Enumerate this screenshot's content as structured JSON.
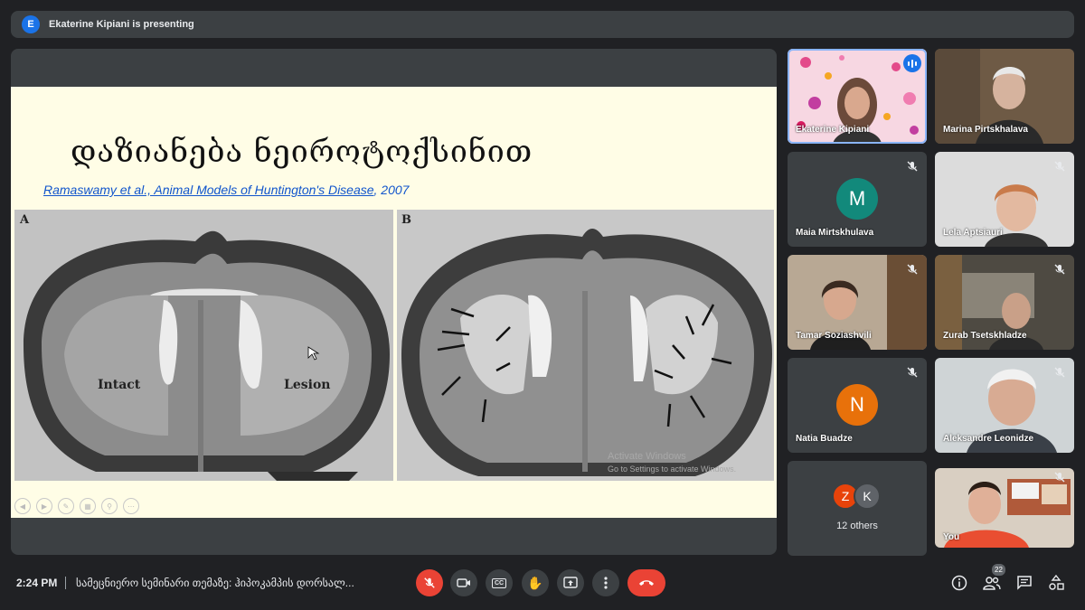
{
  "presenting": {
    "avatar_letter": "E",
    "text": "Ekaterine Kipiani is presenting"
  },
  "slide": {
    "title": "დაზიანება ნეიროტოქსინით",
    "citation_link": "Ramaswamy et al., Animal Models of Huntington's Disease",
    "citation_year": ", 2007",
    "panel_a_label": "A",
    "panel_b_label": "B",
    "label_intact": "Intact",
    "label_lesion": "Lesion",
    "watermark_1": "Activate Windows",
    "watermark_2": "Go to Settings to activate Windows."
  },
  "participants": [
    {
      "name": "Ekaterine Kipiani",
      "speaking": true
    },
    {
      "name": "Marina Pirtskhalava"
    },
    {
      "name": "Maia Mirtskhulava",
      "avatar_letter": "M",
      "avatar_color": "#12897b"
    },
    {
      "name": "Lela Aptsiauri"
    },
    {
      "name": "Tamar Soziashvili"
    },
    {
      "name": "Zurab Tsetskhladze"
    },
    {
      "name": "Natia Buadze",
      "avatar_letter": "N",
      "avatar_color": "#e8710a"
    },
    {
      "name": "Aleksandre Leonidze"
    },
    {
      "name": "You"
    }
  ],
  "others": {
    "avatar_1": "Z",
    "avatar_2": "K",
    "label": "12 others"
  },
  "bottom_bar": {
    "time": "2:24 PM",
    "meeting_title": "სამეცნიერო სემინარი თემაზე: ჰიპოკამპის დორსალ...",
    "participants_count": "22",
    "cc_label": "CC"
  },
  "colors": {
    "accent": "#8ab4f8",
    "danger": "#ea4335",
    "tile_bg": "#3c4043"
  }
}
